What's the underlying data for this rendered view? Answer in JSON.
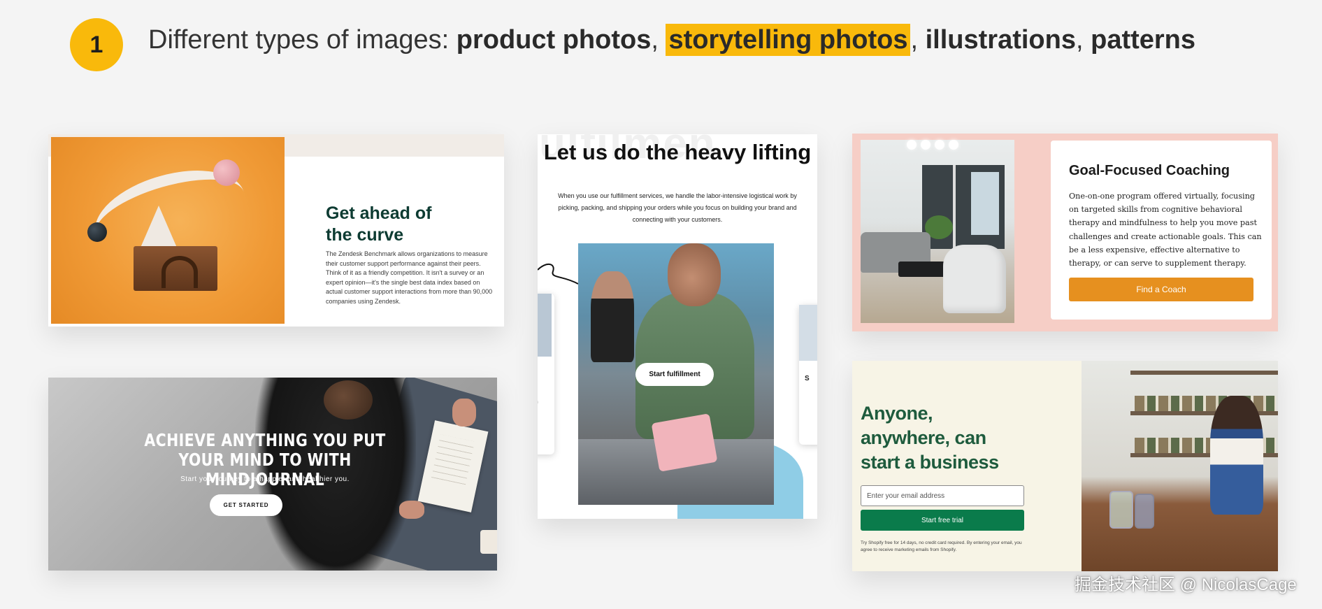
{
  "header": {
    "step_number": "1",
    "prefix": "Different types of images: ",
    "item1": "product photos",
    "sep1": ", ",
    "item2_highlighted": "storytelling photos",
    "sep2": ", ",
    "item3": "illustrations",
    "sep3": ", ",
    "item4": "patterns",
    "highlight_color": "#f9b90b"
  },
  "zendesk": {
    "title_line1": "Get ahead of",
    "title_line2": "the curve",
    "body": "The Zendesk Benchmark allows organizations to measure their customer support performance against their peers. Think of it as a friendly competition. It isn't a survey or an expert opinion—it's the single best data index based on actual customer support interactions from more than 90,000 companies using Zendesk.",
    "title_color": "#0d3b32"
  },
  "mindjournal": {
    "headline": "Achieve anything you put your mind to with MindJournal",
    "subtitle": "Start your journey to a happier and healthier you.",
    "cta_label": "GET STARTED"
  },
  "fulfillment": {
    "ghost_text": "ulfilmen",
    "title": "Let us do the heavy lifting",
    "body": "When you use our fulfillment services, we handle the labor-intensive logistical work by picking, packing, and shipping your orders while you focus on building your brand and connecting with your customers.",
    "cta_label": "Start fulfillment",
    "side_left_text": "th",
    "side_right_text": "S"
  },
  "coaching": {
    "title": "Goal-Focused Coaching",
    "body": "One-on-one program offered virtually, focusing on targeted skills from cognitive behavioral therapy and mindfulness to help you move past challenges and create actionable goals. This can be a less expensive, effective alternative to therapy, or can serve to supplement therapy.",
    "cta_label": "Find a Coach",
    "accent_color": "#e6901f",
    "panel_bg": "#f6cec6"
  },
  "shopify": {
    "title_line1": "Anyone,",
    "title_line2": "anywhere, can",
    "title_line3": "start a business",
    "email_placeholder": "Enter your email address",
    "cta_label": "Start free trial",
    "fine_print": "Try Shopify free for 14 days, no credit card required. By entering your email, you agree to receive marketing emails from Shopify.",
    "brand_color": "#0a7b4b"
  },
  "watermark": "掘金技术社区 @ NicolasCage"
}
